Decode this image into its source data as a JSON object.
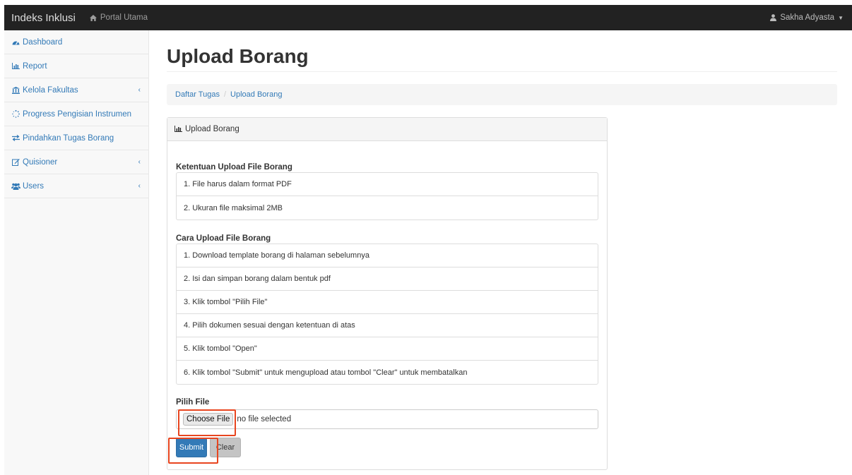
{
  "navbar": {
    "brand": "Indeks Inklusi",
    "portal_label": "Portal Utama",
    "user_name": "Sakha Adyasta"
  },
  "sidebar": {
    "items": [
      {
        "label": "Dashboard",
        "icon": "tachometer-icon"
      },
      {
        "label": "Report",
        "icon": "bar-chart-icon"
      },
      {
        "label": "Kelola Fakultas",
        "icon": "institution-icon"
      },
      {
        "label": "Progress Pengisian Instrumen",
        "icon": "spinner-icon"
      },
      {
        "label": "Pindahkan Tugas Borang",
        "icon": "exchange-icon"
      },
      {
        "label": "Quisioner",
        "icon": "edit-icon"
      },
      {
        "label": "Users",
        "icon": "users-icon"
      }
    ]
  },
  "main": {
    "title": "Upload Borang",
    "breadcrumb": [
      "Daftar Tugas",
      "Upload Borang"
    ],
    "panel": {
      "heading": "Upload Borang",
      "rules_title": "Ketentuan Upload File Borang",
      "rules": [
        "1. File harus dalam format PDF",
        "2. Ukuran file maksimal 2MB"
      ],
      "steps_title": "Cara Upload File Borang",
      "steps": [
        "1. Download template borang di halaman sebelumnya",
        "2. Isi dan simpan borang dalam bentuk pdf",
        "3. Klik tombol \"Pilih File\"",
        "4. Pilih dokumen sesuai dengan ketentuan di atas",
        "5. Klik tombol \"Open\"",
        "6. Klik tombol \"Submit\" untuk mengupload atau tombol \"Clear\" untuk membatalkan"
      ],
      "file_label": "Pilih File",
      "choose_file": "Choose File",
      "no_file": "no file selected",
      "submit": "Submit",
      "clear": "Clear"
    }
  },
  "colors": {
    "navbar_bg": "#222222",
    "link": "#337ab7",
    "primary_button": "#337ab7",
    "highlight": "#e8451f"
  }
}
